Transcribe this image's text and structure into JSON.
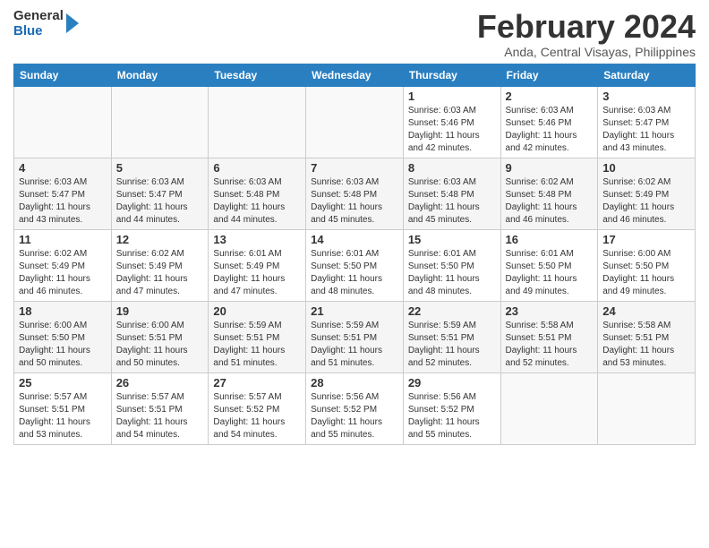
{
  "header": {
    "logo_general": "General",
    "logo_blue": "Blue",
    "month_title": "February 2024",
    "location": "Anda, Central Visayas, Philippines"
  },
  "weekdays": [
    "Sunday",
    "Monday",
    "Tuesday",
    "Wednesday",
    "Thursday",
    "Friday",
    "Saturday"
  ],
  "weeks": [
    [
      {
        "day": "",
        "sunrise": "",
        "sunset": "",
        "daylight": ""
      },
      {
        "day": "",
        "sunrise": "",
        "sunset": "",
        "daylight": ""
      },
      {
        "day": "",
        "sunrise": "",
        "sunset": "",
        "daylight": ""
      },
      {
        "day": "",
        "sunrise": "",
        "sunset": "",
        "daylight": ""
      },
      {
        "day": "1",
        "sunrise": "6:03 AM",
        "sunset": "5:46 PM",
        "daylight": "11 hours and 42 minutes."
      },
      {
        "day": "2",
        "sunrise": "6:03 AM",
        "sunset": "5:46 PM",
        "daylight": "11 hours and 42 minutes."
      },
      {
        "day": "3",
        "sunrise": "6:03 AM",
        "sunset": "5:47 PM",
        "daylight": "11 hours and 43 minutes."
      }
    ],
    [
      {
        "day": "4",
        "sunrise": "6:03 AM",
        "sunset": "5:47 PM",
        "daylight": "11 hours and 43 minutes."
      },
      {
        "day": "5",
        "sunrise": "6:03 AM",
        "sunset": "5:47 PM",
        "daylight": "11 hours and 44 minutes."
      },
      {
        "day": "6",
        "sunrise": "6:03 AM",
        "sunset": "5:48 PM",
        "daylight": "11 hours and 44 minutes."
      },
      {
        "day": "7",
        "sunrise": "6:03 AM",
        "sunset": "5:48 PM",
        "daylight": "11 hours and 45 minutes."
      },
      {
        "day": "8",
        "sunrise": "6:03 AM",
        "sunset": "5:48 PM",
        "daylight": "11 hours and 45 minutes."
      },
      {
        "day": "9",
        "sunrise": "6:02 AM",
        "sunset": "5:48 PM",
        "daylight": "11 hours and 46 minutes."
      },
      {
        "day": "10",
        "sunrise": "6:02 AM",
        "sunset": "5:49 PM",
        "daylight": "11 hours and 46 minutes."
      }
    ],
    [
      {
        "day": "11",
        "sunrise": "6:02 AM",
        "sunset": "5:49 PM",
        "daylight": "11 hours and 46 minutes."
      },
      {
        "day": "12",
        "sunrise": "6:02 AM",
        "sunset": "5:49 PM",
        "daylight": "11 hours and 47 minutes."
      },
      {
        "day": "13",
        "sunrise": "6:01 AM",
        "sunset": "5:49 PM",
        "daylight": "11 hours and 47 minutes."
      },
      {
        "day": "14",
        "sunrise": "6:01 AM",
        "sunset": "5:50 PM",
        "daylight": "11 hours and 48 minutes."
      },
      {
        "day": "15",
        "sunrise": "6:01 AM",
        "sunset": "5:50 PM",
        "daylight": "11 hours and 48 minutes."
      },
      {
        "day": "16",
        "sunrise": "6:01 AM",
        "sunset": "5:50 PM",
        "daylight": "11 hours and 49 minutes."
      },
      {
        "day": "17",
        "sunrise": "6:00 AM",
        "sunset": "5:50 PM",
        "daylight": "11 hours and 49 minutes."
      }
    ],
    [
      {
        "day": "18",
        "sunrise": "6:00 AM",
        "sunset": "5:50 PM",
        "daylight": "11 hours and 50 minutes."
      },
      {
        "day": "19",
        "sunrise": "6:00 AM",
        "sunset": "5:51 PM",
        "daylight": "11 hours and 50 minutes."
      },
      {
        "day": "20",
        "sunrise": "5:59 AM",
        "sunset": "5:51 PM",
        "daylight": "11 hours and 51 minutes."
      },
      {
        "day": "21",
        "sunrise": "5:59 AM",
        "sunset": "5:51 PM",
        "daylight": "11 hours and 51 minutes."
      },
      {
        "day": "22",
        "sunrise": "5:59 AM",
        "sunset": "5:51 PM",
        "daylight": "11 hours and 52 minutes."
      },
      {
        "day": "23",
        "sunrise": "5:58 AM",
        "sunset": "5:51 PM",
        "daylight": "11 hours and 52 minutes."
      },
      {
        "day": "24",
        "sunrise": "5:58 AM",
        "sunset": "5:51 PM",
        "daylight": "11 hours and 53 minutes."
      }
    ],
    [
      {
        "day": "25",
        "sunrise": "5:57 AM",
        "sunset": "5:51 PM",
        "daylight": "11 hours and 53 minutes."
      },
      {
        "day": "26",
        "sunrise": "5:57 AM",
        "sunset": "5:51 PM",
        "daylight": "11 hours and 54 minutes."
      },
      {
        "day": "27",
        "sunrise": "5:57 AM",
        "sunset": "5:52 PM",
        "daylight": "11 hours and 54 minutes."
      },
      {
        "day": "28",
        "sunrise": "5:56 AM",
        "sunset": "5:52 PM",
        "daylight": "11 hours and 55 minutes."
      },
      {
        "day": "29",
        "sunrise": "5:56 AM",
        "sunset": "5:52 PM",
        "daylight": "11 hours and 55 minutes."
      },
      {
        "day": "",
        "sunrise": "",
        "sunset": "",
        "daylight": ""
      },
      {
        "day": "",
        "sunrise": "",
        "sunset": "",
        "daylight": ""
      }
    ]
  ]
}
